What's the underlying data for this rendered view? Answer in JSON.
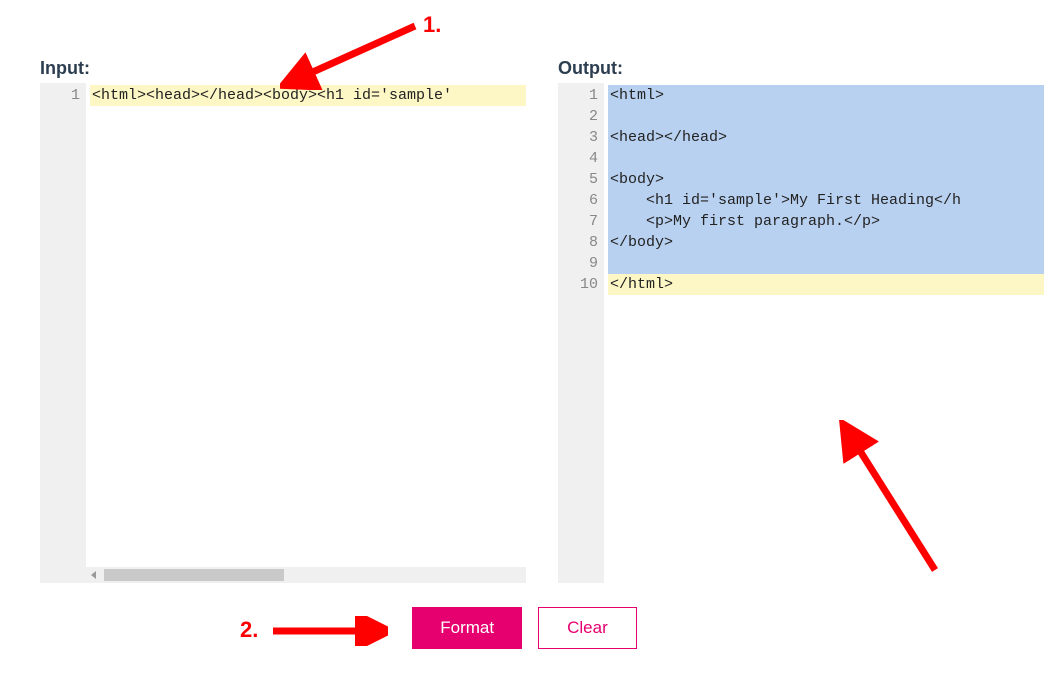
{
  "input": {
    "label": "Input:",
    "lines": [
      {
        "n": 1,
        "text": "<html><head></head><body><h1 id='sample'",
        "hl": "yellow"
      }
    ]
  },
  "output": {
    "label": "Output:",
    "lines": [
      {
        "n": 1,
        "text": "<html>",
        "hl": "blue"
      },
      {
        "n": 2,
        "text": "",
        "hl": "blue"
      },
      {
        "n": 3,
        "text": "<head></head>",
        "hl": "blue"
      },
      {
        "n": 4,
        "text": "",
        "hl": "blue"
      },
      {
        "n": 5,
        "text": "<body>",
        "hl": "blue"
      },
      {
        "n": 6,
        "text": "    <h1 id='sample'>My First Heading</h",
        "hl": "blue"
      },
      {
        "n": 7,
        "text": "    <p>My first paragraph.</p>",
        "hl": "blue"
      },
      {
        "n": 8,
        "text": "</body>",
        "hl": "blue"
      },
      {
        "n": 9,
        "text": "",
        "hl": "blue"
      },
      {
        "n": 10,
        "text": "</html>",
        "hl": "yellow"
      }
    ]
  },
  "buttons": {
    "format": "Format",
    "clear": "Clear"
  },
  "annotations": {
    "one": "1.",
    "two": "2."
  }
}
